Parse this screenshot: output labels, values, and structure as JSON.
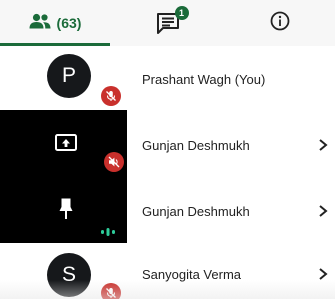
{
  "tabs": {
    "participants_count": "(63)",
    "chat_unread": "1"
  },
  "participants": [
    {
      "initial": "P",
      "name": "Prashant Wagh (You)",
      "mic": "muted"
    },
    {
      "name": "Gunjan Deshmukh",
      "tile": "screen-share",
      "mic": "muted"
    },
    {
      "name": "Gunjan Deshmukh",
      "tile": "pinned-video",
      "audio": "speaking"
    },
    {
      "initial": "S",
      "name": "Sanyogita Verma",
      "mic": "muted"
    }
  ],
  "colors": {
    "accent": "#1b6b3a",
    "muted_badge": "#c9302c",
    "speaking": "#2ecc9a",
    "avatar_bg": "#16181b"
  }
}
